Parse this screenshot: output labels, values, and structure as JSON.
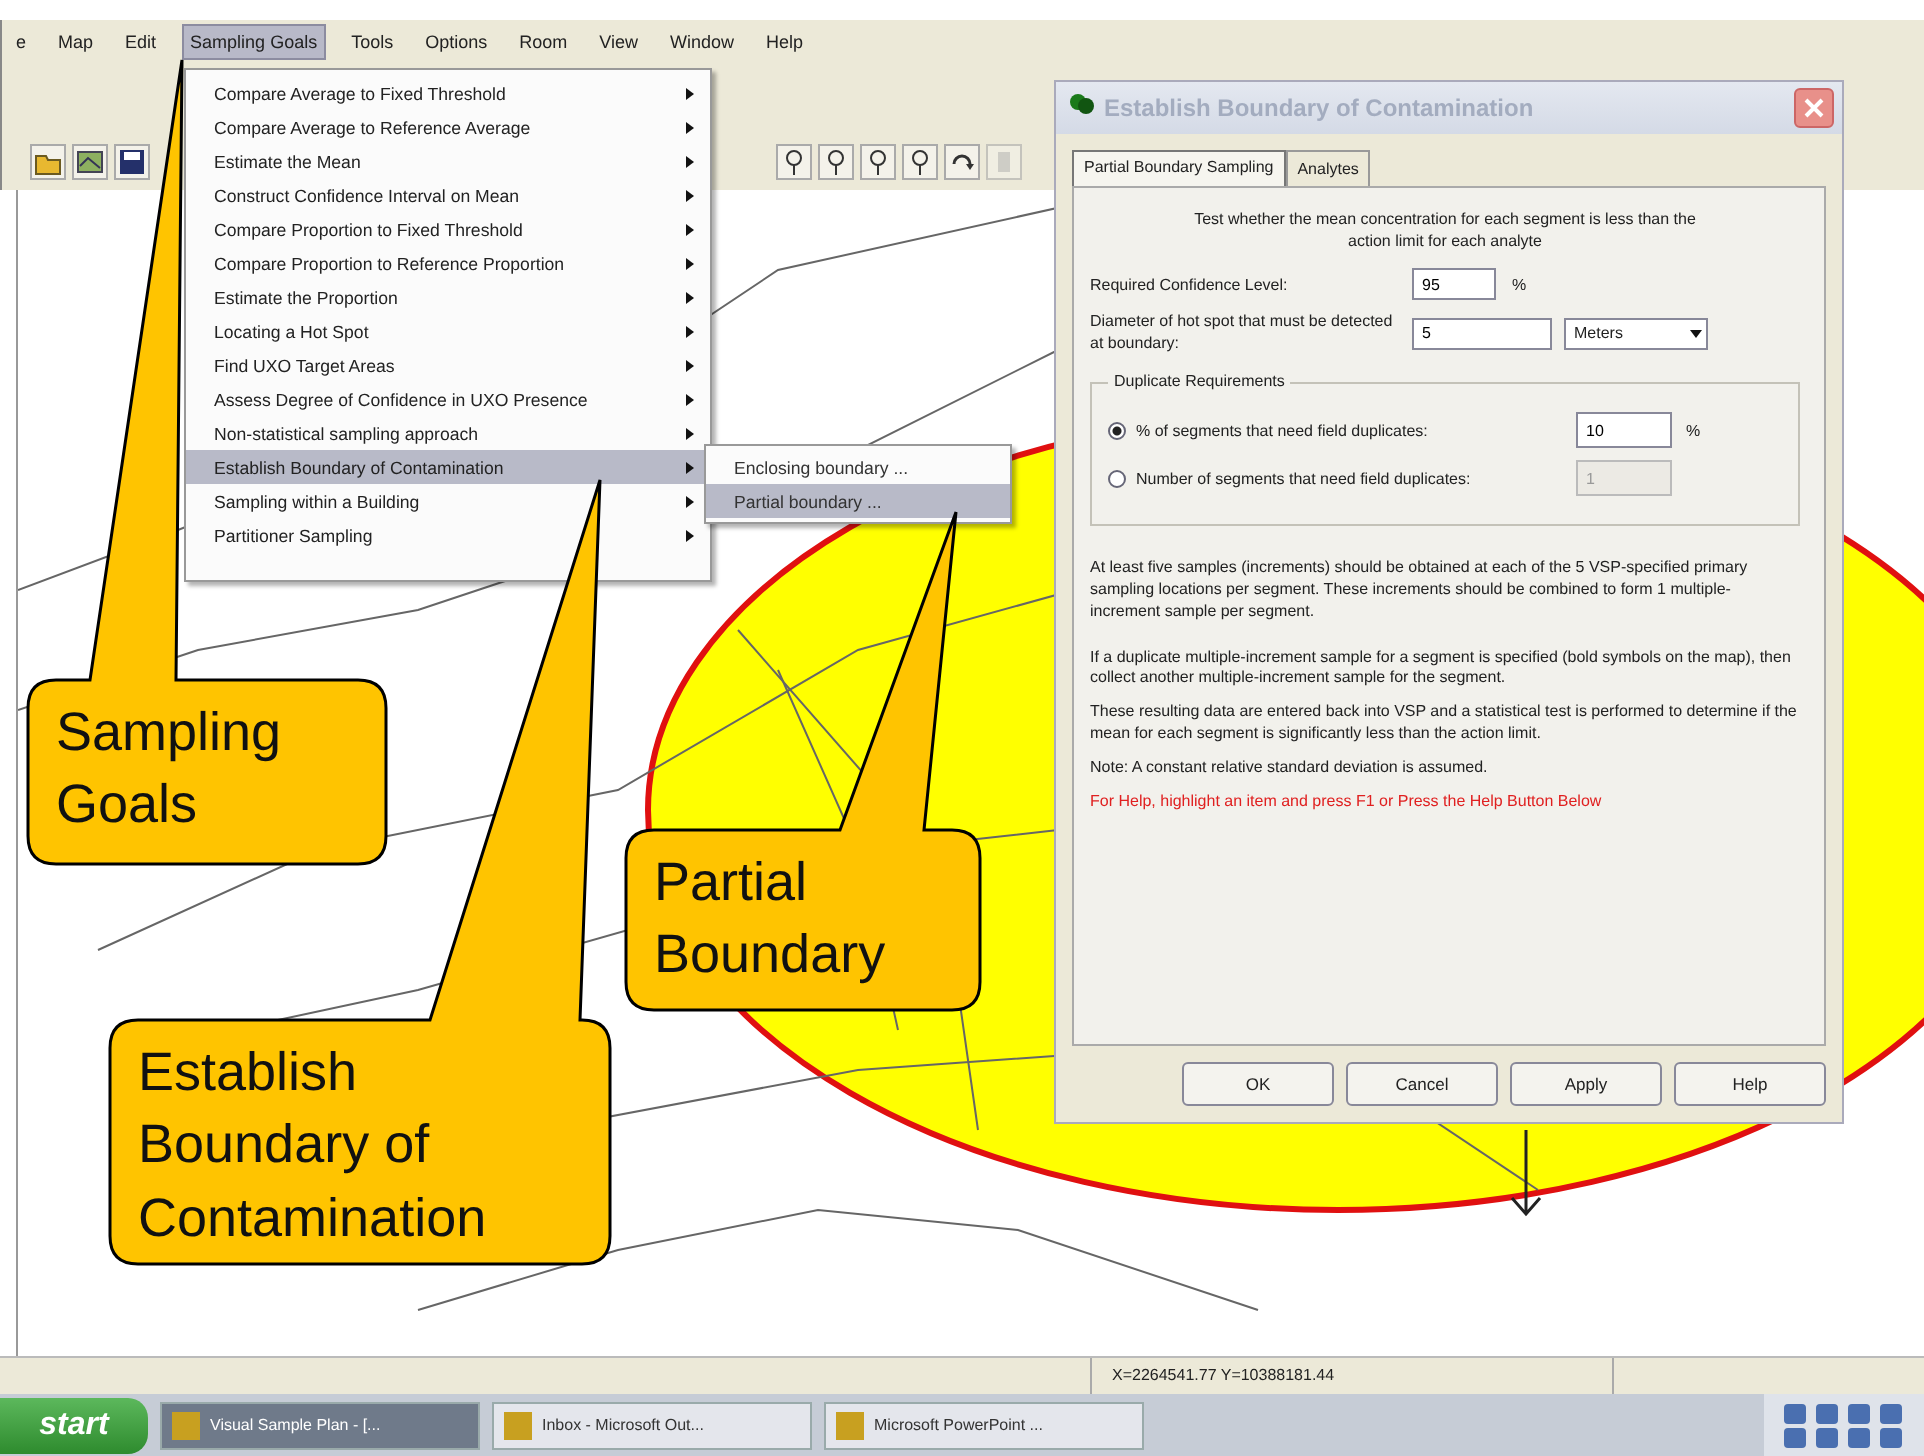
{
  "menu_bar": [
    {
      "label": "e",
      "selected": false
    },
    {
      "label": "Map",
      "selected": false
    },
    {
      "label": "Edit",
      "selected": false
    },
    {
      "label": "Sampling Goals",
      "selected": true
    },
    {
      "label": "Tools",
      "selected": false
    },
    {
      "label": "Options",
      "selected": false
    },
    {
      "label": "Room",
      "selected": false
    },
    {
      "label": "View",
      "selected": false
    },
    {
      "label": "Window",
      "selected": false
    },
    {
      "label": "Help",
      "selected": false
    }
  ],
  "sampling_goals_menu": [
    {
      "label": "Compare Average to Fixed Threshold",
      "selected": false
    },
    {
      "label": "Compare Average to Reference Average",
      "selected": false
    },
    {
      "label": "Estimate the Mean",
      "selected": false
    },
    {
      "label": "Construct Confidence Interval on Mean",
      "selected": false
    },
    {
      "label": "Compare Proportion to Fixed Threshold",
      "selected": false
    },
    {
      "label": "Compare Proportion to Reference Proportion",
      "selected": false
    },
    {
      "label": "Estimate the Proportion",
      "selected": false
    },
    {
      "label": "Locating a Hot Spot",
      "selected": false
    },
    {
      "label": "Find UXO Target Areas",
      "selected": false
    },
    {
      "label": "Assess Degree of Confidence in UXO Presence",
      "selected": false
    },
    {
      "label": "Non-statistical sampling approach",
      "selected": false
    },
    {
      "label": "Establish Boundary of Contamination",
      "selected": true
    },
    {
      "label": "Sampling within a Building",
      "selected": false
    },
    {
      "label": "Partitioner Sampling",
      "selected": false
    }
  ],
  "submenu": [
    {
      "label": "Enclosing boundary ...",
      "selected": false
    },
    {
      "label": "Partial boundary ...",
      "selected": true
    }
  ],
  "dialog": {
    "title": "Establish Boundary of Contamination",
    "tabs": [
      {
        "label": "Partial Boundary Sampling",
        "selected": true
      },
      {
        "label": "Analytes",
        "selected": false
      }
    ],
    "intro": "Test whether the mean concentration for each segment is less than the action limit for each analyte",
    "confidence_label": "Required Confidence Level:",
    "confidence_value": "95",
    "confidence_unit": "%",
    "diameter_label": "Diameter of hot spot that must be detected at boundary:",
    "diameter_value": "5",
    "diameter_unit": "Meters",
    "group_title": "Duplicate Requirements",
    "options": [
      {
        "label": "% of segments that need field duplicates:",
        "selected": true,
        "value": "10",
        "unit": "%"
      },
      {
        "label": "Number of segments that need field duplicates:",
        "selected": false,
        "value": "1"
      }
    ],
    "paragraphs": [
      "At least five samples (increments) should be obtained at each of the 5 VSP-specified primary sampling locations per segment.  These increments should be combined to form 1 multiple-increment sample per segment.",
      "If a duplicate multiple-increment sample for a segment is specified (bold symbols on the map), then collect another multiple-increment sample for the segment.",
      "These resulting data are entered back into VSP and a statistical test is performed to determine if the mean for each segment is significantly less than the action limit.",
      "Note:  A constant relative standard deviation is assumed."
    ],
    "help_hint": "For Help, highlight an item and press F1 or Press the Help Button Below",
    "buttons": [
      "OK",
      "Cancel",
      "Apply",
      "Help"
    ]
  },
  "status_bar": "X=2264541.77 Y=10388181.44",
  "taskbar": {
    "start": "start",
    "tasks": [
      {
        "label": "Visual Sample Plan - [...",
        "selected": true
      },
      {
        "label": "Inbox - Microsoft Out...",
        "selected": false
      },
      {
        "label": "Microsoft PowerPoint ...",
        "selected": false
      }
    ]
  },
  "callouts": [
    {
      "text": "Sampling Goals"
    },
    {
      "text": "Establish Boundary of Contamination"
    },
    {
      "text": "Partial Boundary"
    }
  ]
}
